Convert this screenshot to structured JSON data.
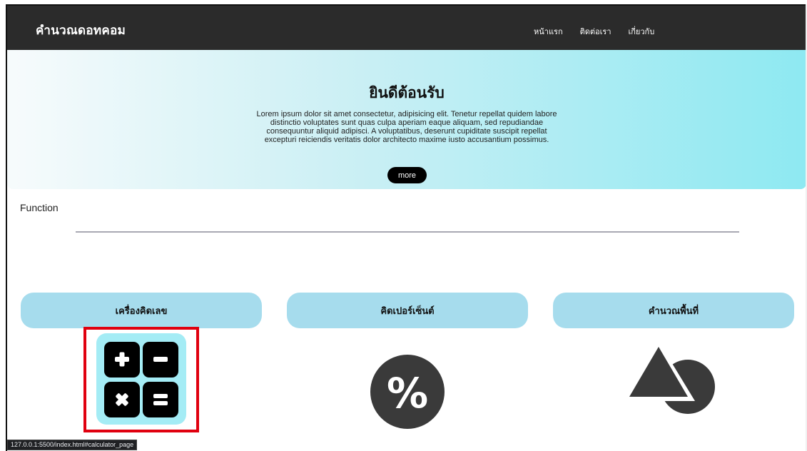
{
  "navbar": {
    "brand": "คำนวณดอทคอม",
    "links": [
      {
        "label": "หน้าแรก"
      },
      {
        "label": "ติดต่อเรา"
      },
      {
        "label": "เกี่ยวกับ"
      }
    ]
  },
  "hero": {
    "title": "ยินดีต้อนรับ",
    "text": "Lorem ipsum dolor sit amet consectetur, adipisicing elit. Tenetur repellat quidem labore distinctio voluptates sunt quas culpa aperiam eaque aliquam, sed repudiandae consequuntur aliquid adipisci. A voluptatibus, deserunt cupiditate suscipit repellat excepturi reiciendis veritatis dolor architecto maxime iusto accusantium possimus.",
    "more_label": "more"
  },
  "functions": {
    "section_label": "Function",
    "cards": [
      {
        "title": "เครื่องคิดเลข",
        "icon": "calculator-icon",
        "highlighted": true
      },
      {
        "title": "คิดเปอร์เซ็นต์",
        "icon": "percent-icon",
        "highlighted": false
      },
      {
        "title": "คำนวณพื้นที่",
        "icon": "shapes-icon",
        "highlighted": false
      }
    ]
  },
  "status_bar": {
    "url": "127.0.0.1:5500/index.html#calculator_page"
  },
  "colors": {
    "navbar_bg": "#2b2b2b",
    "card_head_bg": "#a6dced",
    "highlight_border": "#e0000f",
    "icon_dark": "#3a3a3a",
    "calculator_bg": "#a4ecf5"
  }
}
